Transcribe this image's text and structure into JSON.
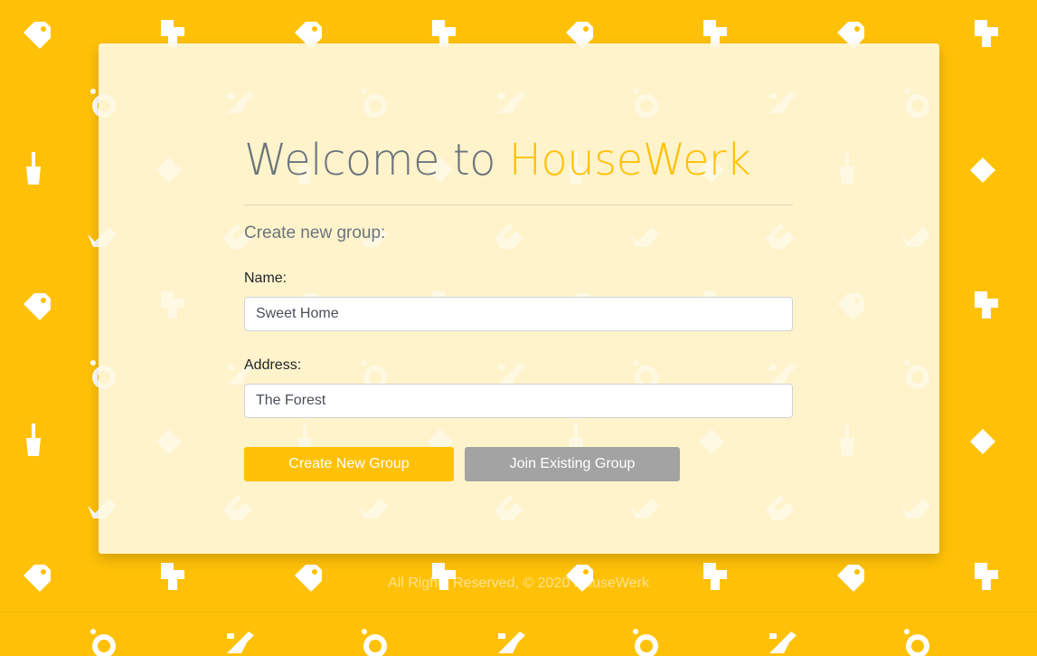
{
  "welcome": {
    "prefix": "Welcome to ",
    "brand": "HouseWerk"
  },
  "form": {
    "heading": "Create new group:",
    "name_label": "Name:",
    "name_value": "Sweet Home",
    "address_label": "Address:",
    "address_value": "The Forest"
  },
  "actions": {
    "create_label": "Create New Group",
    "join_label": "Join Existing Group"
  },
  "footer": {
    "text": "All Rights Reserved, © 2020 HouseWerk"
  },
  "colors": {
    "brand": "#FFC107",
    "card": "#FFF8E1",
    "muted_button": "#A3A3A3"
  },
  "background_icons": [
    "tag-icon",
    "dustpan-icon",
    "laundry-icon",
    "spray-bottle-icon",
    "broom-icon",
    "sponge-icon",
    "mop-icon",
    "clean-surface-icon"
  ]
}
